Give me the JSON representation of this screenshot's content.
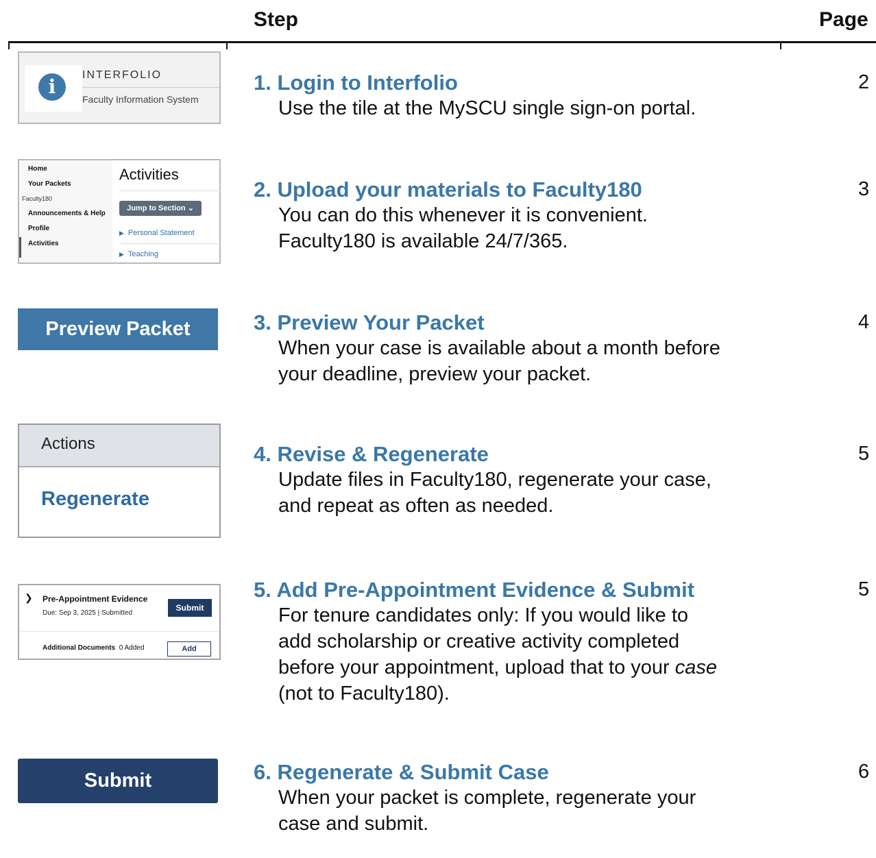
{
  "header": {
    "step": "Step",
    "page": "Page"
  },
  "thumbs": {
    "interfolio": {
      "icon": "info-icon",
      "icon_glyph": "i",
      "brand": "INTERFOLIO",
      "subtitle": "Faculty Information System"
    },
    "activities": {
      "nav": [
        "Home",
        "Your Packets",
        "Faculty180",
        "Announcements & Help",
        "Profile",
        "Activities"
      ],
      "title": "Activities",
      "jump": "Jump to Section",
      "links": [
        "Personal Statement",
        "Teaching"
      ]
    },
    "preview": {
      "label": "Preview Packet"
    },
    "actions": {
      "header": "Actions",
      "regenerate": "Regenerate"
    },
    "preapp": {
      "title": "Pre-Appointment Evidence",
      "due": "Due: Sep 3, 2025 |  Submitted",
      "submit": "Submit",
      "docs_label": "Additional Documents",
      "docs_count": "0 Added",
      "add": "Add"
    },
    "submit": {
      "label": "Submit"
    }
  },
  "steps": [
    {
      "title": "1. Login to Interfolio",
      "desc": "Use the tile at the MySCU single sign-on portal.",
      "page": "2"
    },
    {
      "title": "2. Upload your materials to Faculty180",
      "desc_lines": [
        "You can do this whenever it is convenient.",
        "Faculty180 is available 24/7/365."
      ],
      "page": "3"
    },
    {
      "title": "3. Preview Your Packet",
      "desc_lines": [
        "When your case is available about a month before",
        "your deadline, preview your packet."
      ],
      "page": "4"
    },
    {
      "title": "4. Revise & Regenerate",
      "desc_lines": [
        "Update files in Faculty180, regenerate your case,",
        "and repeat as often as needed."
      ],
      "page": "5"
    },
    {
      "title": "5. Add Pre-Appointment Evidence & Submit",
      "desc_lines": [
        "For tenure candidates only: If you would like to",
        "add scholarship or creative activity completed",
        "before your appointment, upload that to your",
        "case",
        "(not to Faculty180)."
      ],
      "page": "5"
    },
    {
      "title": "6. Regenerate & Submit Case",
      "desc_lines": [
        "When your packet is complete, regenerate your",
        "case and submit."
      ],
      "page": "6"
    }
  ]
}
